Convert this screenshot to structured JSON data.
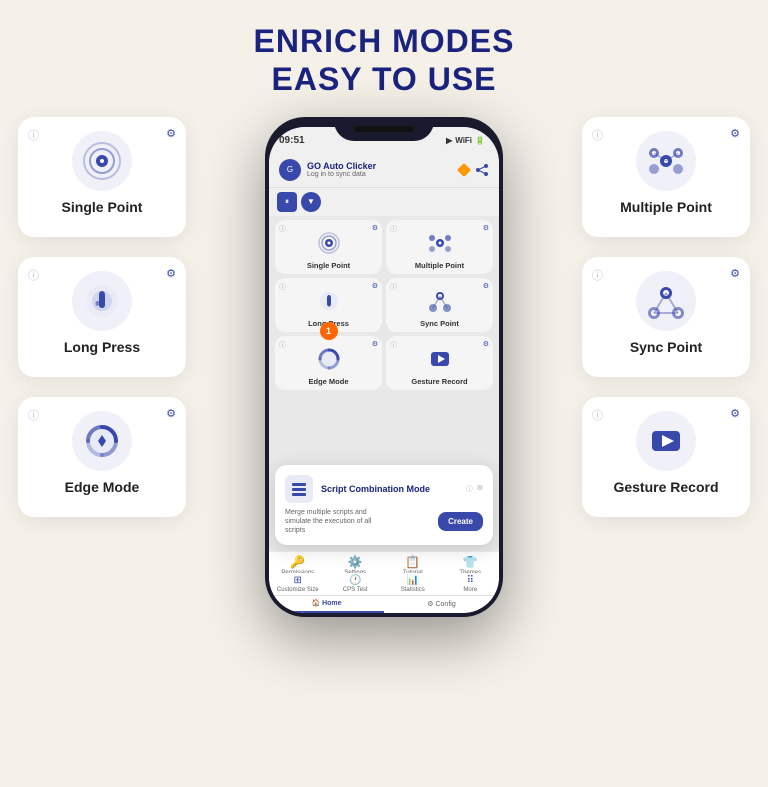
{
  "header": {
    "title_line1": "ENRICH MODES",
    "title_line2": "EASY TO USE"
  },
  "phone": {
    "status_time": "09:51",
    "app_name": "GO Auto Clicker",
    "app_sub": "Log in to sync data",
    "controls": {
      "pause": "⏸",
      "down": "▼"
    },
    "modes": [
      {
        "label": "Single Point",
        "icon": "single"
      },
      {
        "label": "Multiple Point",
        "icon": "multi"
      },
      {
        "label": "Long Press",
        "icon": "longpress"
      },
      {
        "label": "Sync Point",
        "icon": "sync"
      },
      {
        "label": "Edge Mode",
        "icon": "edge"
      },
      {
        "label": "Gesture Record",
        "icon": "gesture"
      }
    ],
    "script_popup": {
      "title": "Script Combination Mode",
      "description": "Merge multiple scripts and simulate the execution of all scripts",
      "create_label": "Create"
    },
    "bottom_nav": [
      {
        "label": "Permissions",
        "icon": "🔑"
      },
      {
        "label": "Settings",
        "icon": "⚙️"
      },
      {
        "label": "Tutorial",
        "icon": "📋"
      },
      {
        "label": "Themes",
        "icon": "👕"
      }
    ],
    "bottom_nav2": [
      {
        "label": "Customize Size",
        "icon": "⊞"
      },
      {
        "label": "CPS Test",
        "icon": "🕐"
      },
      {
        "label": "Statistics",
        "icon": "📊"
      },
      {
        "label": "More",
        "icon": "⠿"
      }
    ],
    "tabs": [
      {
        "label": "Home",
        "active": true
      },
      {
        "label": "Config",
        "active": false
      }
    ]
  },
  "left_cards": [
    {
      "id": "single-point",
      "label": "Single Point"
    },
    {
      "id": "long-press",
      "label": "Long Press"
    },
    {
      "id": "edge-mode",
      "label": "Edge Mode"
    }
  ],
  "right_cards": [
    {
      "id": "multiple-point",
      "label": "Multiple Point"
    },
    {
      "id": "sync-point",
      "label": "Sync Point"
    },
    {
      "id": "gesture-record",
      "label": "Gesture Record"
    }
  ],
  "colors": {
    "primary": "#3949ab",
    "accent": "#ff6600",
    "bg": "#f5f0e8",
    "card_bg": "#f0f0f8"
  }
}
